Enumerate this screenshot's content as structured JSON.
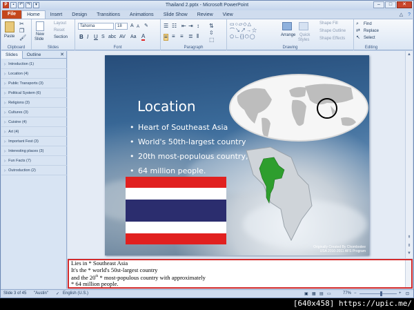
{
  "window": {
    "title": "Thailand 2.pptx  -  Microsoft PowerPoint"
  },
  "tabs": [
    "File",
    "Home",
    "Insert",
    "Design",
    "Transitions",
    "Animations",
    "Slide Show",
    "Review",
    "View"
  ],
  "ribbon": {
    "clipboard": {
      "label": "Clipboard",
      "paste": "Paste"
    },
    "slides": {
      "label": "Slides",
      "new_slide": "New",
      "new_slide2": "Slide",
      "layout": "Layout",
      "reset": "Reset",
      "section": "Section"
    },
    "font": {
      "label": "Font",
      "name": "Tahoma",
      "size": "18"
    },
    "paragraph": {
      "label": "Paragraph"
    },
    "drawing": {
      "label": "Drawing",
      "arrange": "Arrange",
      "quick_styles": "Quick",
      "quick_styles2": "Styles",
      "shape_fill": "Shape Fill",
      "shape_outline": "Shape Outline",
      "shape_effects": "Shape Effects"
    },
    "editing": {
      "label": "Editing",
      "find": "Find",
      "replace": "Replace",
      "select": "Select"
    }
  },
  "pane": {
    "tabs": [
      "Slides",
      "Outline"
    ],
    "sections": [
      "Introduction (1)",
      "Location (4)",
      "Public Transports (3)",
      "Political System (6)",
      "Religions (3)",
      "Cultures (3)",
      "Cuisine (4)",
      "Art (4)",
      "Important Fest (3)",
      "Interesting places (3)",
      "Fun Facts (7)",
      "Outroduction (2)"
    ]
  },
  "slide": {
    "title": "Location",
    "bullets": [
      "Heart of Southeast Asia",
      "World's 50th-largest country",
      "20th most-populous country,",
      "64 million people."
    ],
    "credit_line1": "Originally Created By Chombodee",
    "credit_line2": "USA 2010-2011 AFS Program"
  },
  "notes": {
    "line1": "Lies in * Southeast Asia",
    "line2": "It's the * world's 50st-largest country",
    "line3a": "and the 20",
    "line3sup": "th",
    "line3b": " * most-populous country with approximately",
    "line4": "* 64 million people."
  },
  "status": {
    "slide": "Slide 3 of 45",
    "theme": "\"Austin\"",
    "lang": "English (U.S.)",
    "zoom": "77%"
  },
  "watermark": "[640x458] https://upic.me/",
  "colors": {
    "file_tab": "#c4471c",
    "notes_border": "#d42a2a",
    "flag_red": "#e1201f",
    "flag_blue": "#2b2d6e"
  }
}
